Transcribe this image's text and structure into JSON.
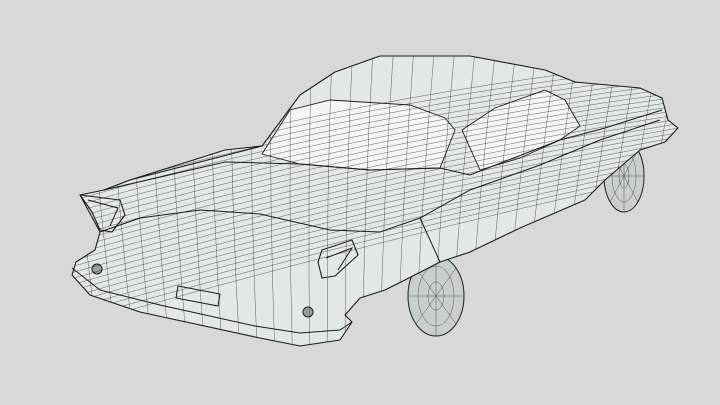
{
  "scene": {
    "subject": "car-wireframe",
    "colors": {
      "background": "#d8d8d8",
      "body_fill": "#e2e8e6",
      "glass_fill": "#f3f6f5",
      "tire_fill": "#c9cfcd",
      "line": "#1c1c1c"
    }
  }
}
